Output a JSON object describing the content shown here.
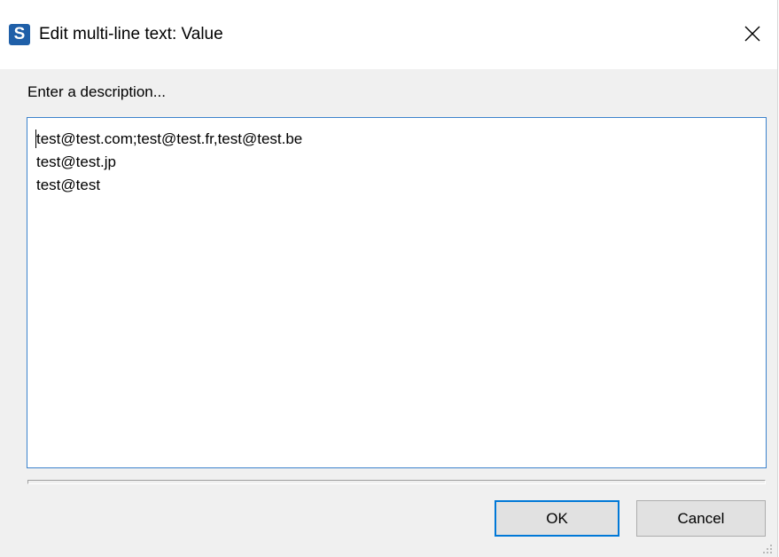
{
  "window": {
    "title": "Edit multi-line text: Value",
    "app_icon_letter": "S",
    "close_glyph": "close-icon"
  },
  "dialog": {
    "prompt": "Enter a description...",
    "text_lines": [
      "test@test.com;test@test.fr,test@test.be",
      "test@test.jp",
      "test@test"
    ]
  },
  "buttons": {
    "ok_label": "OK",
    "cancel_label": "Cancel"
  },
  "colors": {
    "accent": "#0078d7",
    "textarea_border": "#3c82cc",
    "app_icon_bg": "#1f5fa8"
  }
}
